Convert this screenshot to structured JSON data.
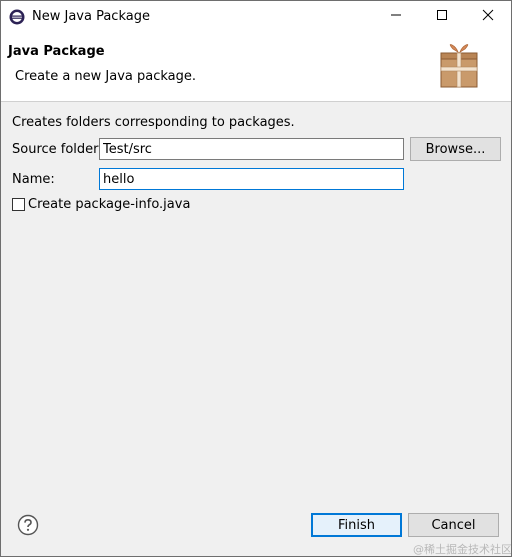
{
  "window": {
    "title": "New Java Package",
    "controls": {
      "minimize_icon": "minimize-icon",
      "maximize_icon": "maximize-icon",
      "close_icon": "close-icon"
    }
  },
  "banner": {
    "title": "Java Package",
    "description": "Create a new Java package.",
    "icon": "package-gift-icon"
  },
  "body": {
    "description": "Creates folders corresponding to packages.",
    "source_folder": {
      "label": "Source folder:",
      "value": "Test/src",
      "browse_label": "Browse..."
    },
    "name": {
      "label": "Name:",
      "value": "hello"
    },
    "package_info": {
      "label": "Create package-info.java",
      "checked": false
    }
  },
  "footer": {
    "help_icon": "help-icon",
    "finish_label": "Finish",
    "cancel_label": "Cancel"
  },
  "watermark": "@稀土掘金技术社区",
  "colors": {
    "accent": "#0078d7",
    "dialog_bg": "#f0f0f0"
  }
}
